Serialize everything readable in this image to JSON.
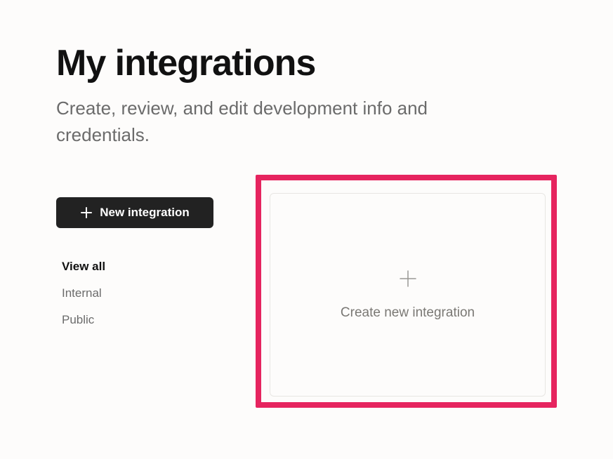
{
  "header": {
    "title": "My integrations",
    "subtitle": "Create, review, and edit development info and credentials."
  },
  "sidebar": {
    "new_button_label": "New integration",
    "filters": [
      {
        "label": "View all",
        "active": true
      },
      {
        "label": "Internal",
        "active": false
      },
      {
        "label": "Public",
        "active": false
      }
    ]
  },
  "main": {
    "create_card_label": "Create new integration"
  },
  "highlight": {
    "color": "#e6245f"
  }
}
